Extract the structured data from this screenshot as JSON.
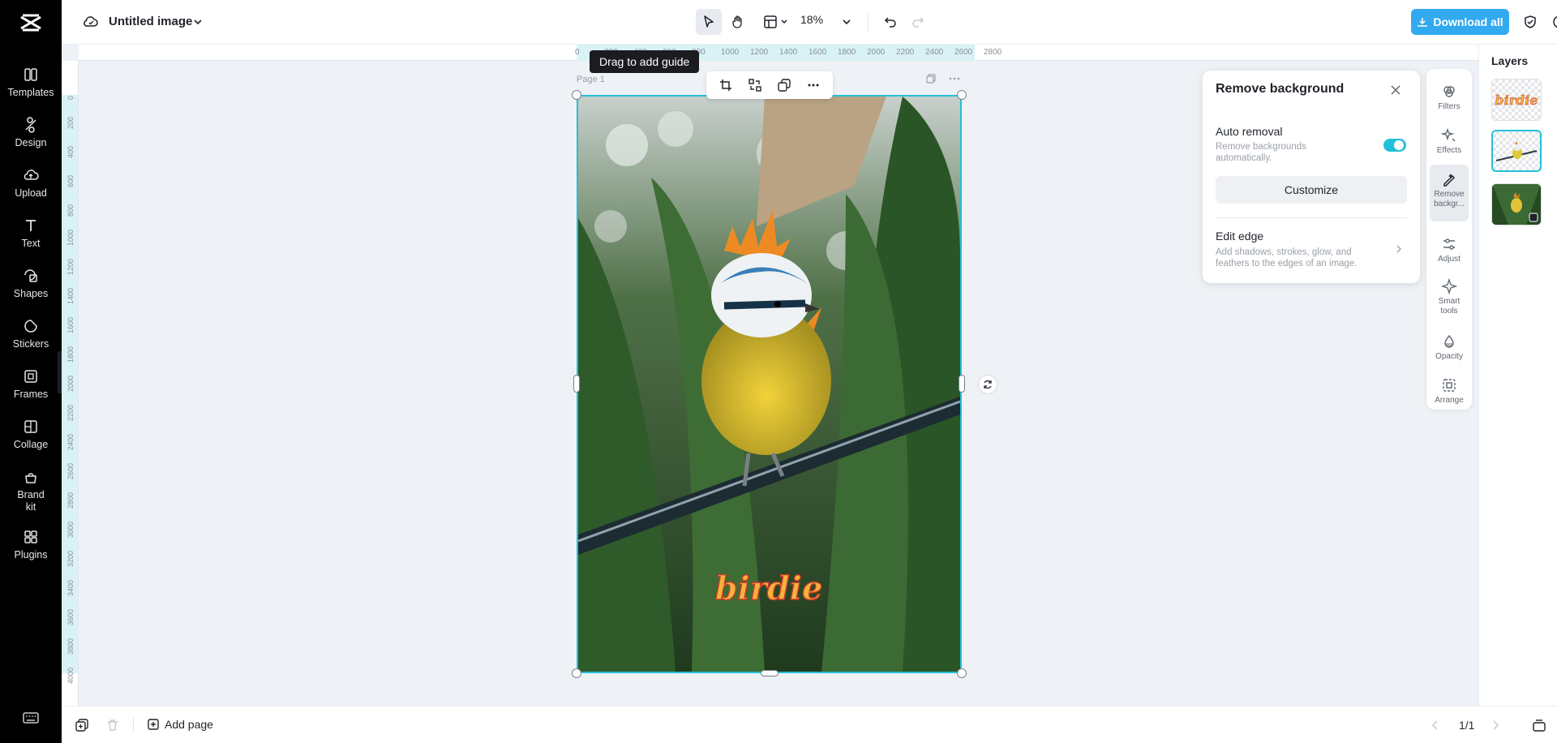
{
  "sidebar": {
    "logo_icon": "capcut-logo-icon",
    "items": [
      {
        "label": "Templates",
        "icon": "templates-icon"
      },
      {
        "label": "Design",
        "icon": "design-icon"
      },
      {
        "label": "Upload",
        "icon": "upload-icon"
      },
      {
        "label": "Text",
        "icon": "text-icon"
      },
      {
        "label": "Shapes",
        "icon": "shapes-icon"
      },
      {
        "label": "Stickers",
        "icon": "stickers-icon"
      },
      {
        "label": "Frames",
        "icon": "frames-icon"
      },
      {
        "label": "Collage",
        "icon": "collage-icon"
      },
      {
        "label": "Brand\nkit",
        "icon": "brand-kit-icon"
      },
      {
        "label": "Plugins",
        "icon": "plugins-icon"
      }
    ],
    "bottom_icon": "keyboard-icon"
  },
  "topbar": {
    "title": "Untitled image",
    "zoom": "18%",
    "download_label": "Download all",
    "accent": "#32aaf0"
  },
  "ruler": {
    "h_ticks": [
      "0",
      "200",
      "400",
      "600",
      "800",
      "1000",
      "1200",
      "1400",
      "1600",
      "1800",
      "2000",
      "2200",
      "2400",
      "2600",
      "2800"
    ],
    "v_ticks": [
      "0",
      "200",
      "400",
      "600",
      "800",
      "1000",
      "1200",
      "1400",
      "1600",
      "1800",
      "2000",
      "2200",
      "2400",
      "2600",
      "2800",
      "3000",
      "3200",
      "3400",
      "3600",
      "3800",
      "4000"
    ]
  },
  "tooltip": "Drag to add guide",
  "canvas": {
    "page_label": "Page 1",
    "image_text": "birdie",
    "selection_color": "#23c0d9"
  },
  "remove_bg_panel": {
    "title": "Remove background",
    "auto_removal_title": "Auto removal",
    "auto_removal_desc": "Remove backgrounds automatically.",
    "auto_removal_on": true,
    "customize_label": "Customize",
    "edit_edge_title": "Edit edge",
    "edit_edge_desc": "Add shadows, strokes, glow, and feathers to the edges of an image."
  },
  "tools": [
    {
      "label": "Filters",
      "icon": "filters-icon"
    },
    {
      "label": "Effects",
      "icon": "effects-icon"
    },
    {
      "label": "Remove\nbackgr...",
      "icon": "remove-background-icon",
      "active": true
    },
    {
      "label": "Adjust",
      "icon": "adjust-icon"
    },
    {
      "label": "Smart\ntools",
      "icon": "smart-tools-icon"
    },
    {
      "label": "Opacity",
      "icon": "opacity-icon"
    },
    {
      "label": "Arrange",
      "icon": "arrange-icon"
    }
  ],
  "layers": {
    "title": "Layers",
    "items": [
      {
        "text": "birdie"
      },
      {
        "text": ""
      },
      {
        "text": ""
      }
    ]
  },
  "bottombar": {
    "add_page_label": "Add page",
    "page_count": "1/1"
  }
}
